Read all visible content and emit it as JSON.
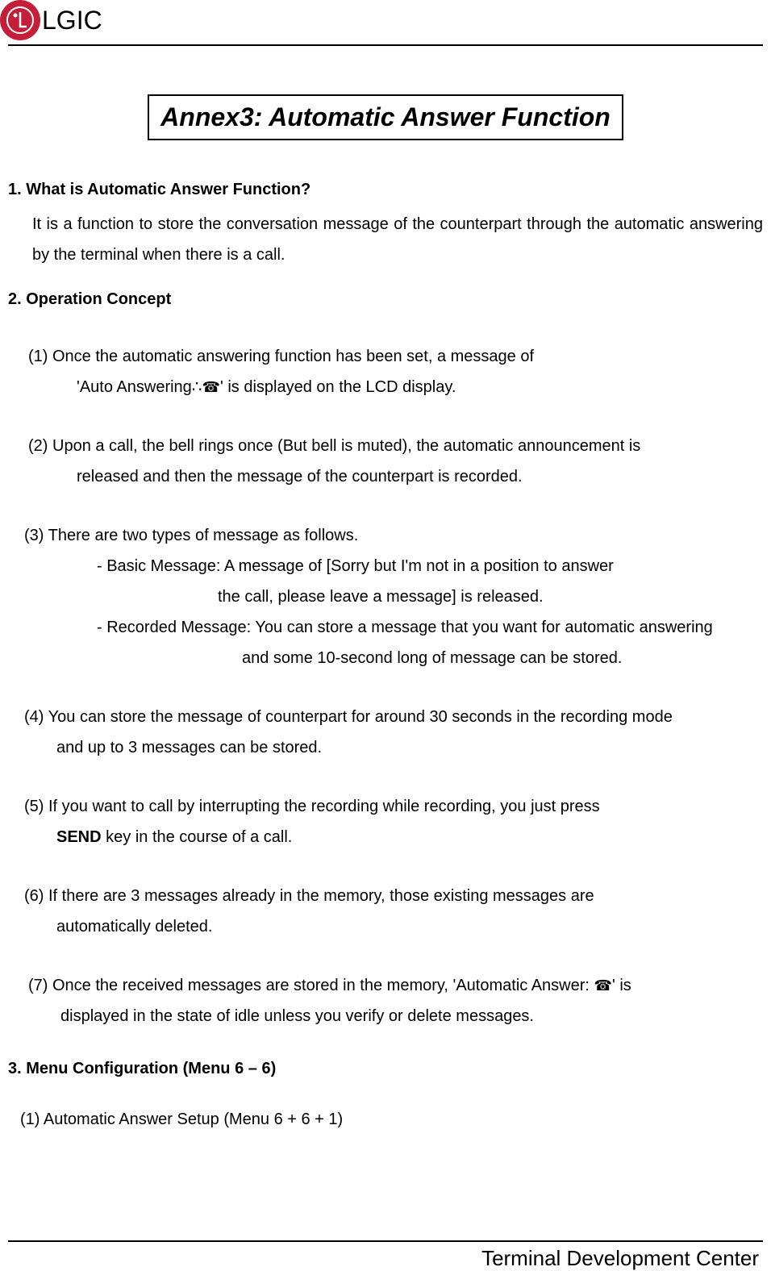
{
  "header": {
    "brand": "LGIC"
  },
  "title": "Annex3: Automatic Answer Function",
  "sections": {
    "s1": {
      "heading": "1. What is Automatic Answer Function?",
      "body": "It is a function to store the conversation message of the counterpart through the automatic answering by the terminal when there is a call."
    },
    "s2": {
      "heading": "2. Operation Concept",
      "items": {
        "i1": {
          "line1": "(1) Once the automatic answering function has been set, a message of",
          "line2a": "'Auto Answering∴",
          "line2b": "' is displayed on the LCD display."
        },
        "i2": {
          "line1": "(2) Upon a call, the bell rings once (But bell is muted), the automatic announcement is",
          "line2": "released and then the message of the counterpart is recorded."
        },
        "i3": {
          "line1": "(3) There are two types of message as follows.",
          "sub1": "- Basic Message: A message of [Sorry but I'm not in a position to answer",
          "sub1cont": "the call, please leave a message] is released.",
          "sub2": "- Recorded Message: You can store a message that you want for automatic answering",
          "sub2cont": "and some 10-second long of message can be stored."
        },
        "i4": {
          "line1": "(4) You can store the message of counterpart for around 30 seconds in the recording mode",
          "line2": "and up to 3 messages can be stored."
        },
        "i5": {
          "line1": "(5) If you want to call by interrupting the recording while recording, you just press",
          "line2a": "SEND",
          "line2b": " key in the course of a call."
        },
        "i6": {
          "line1": "(6) If there are 3 messages already in the memory, those existing messages are",
          "line2": "automatically deleted."
        },
        "i7": {
          "line1a": "(7) Once the received messages are stored in the memory, 'Automatic Answer: ",
          "line1b": "' is",
          "line2": "displayed in the state of idle unless you verify or delete messages."
        }
      }
    },
    "s3": {
      "heading": "3. Menu Configuration (Menu 6 – 6)",
      "item1": "(1)   Automatic Answer Setup (Menu 6 + 6 + 1)"
    }
  },
  "footer": {
    "text": "Terminal Development Center"
  }
}
